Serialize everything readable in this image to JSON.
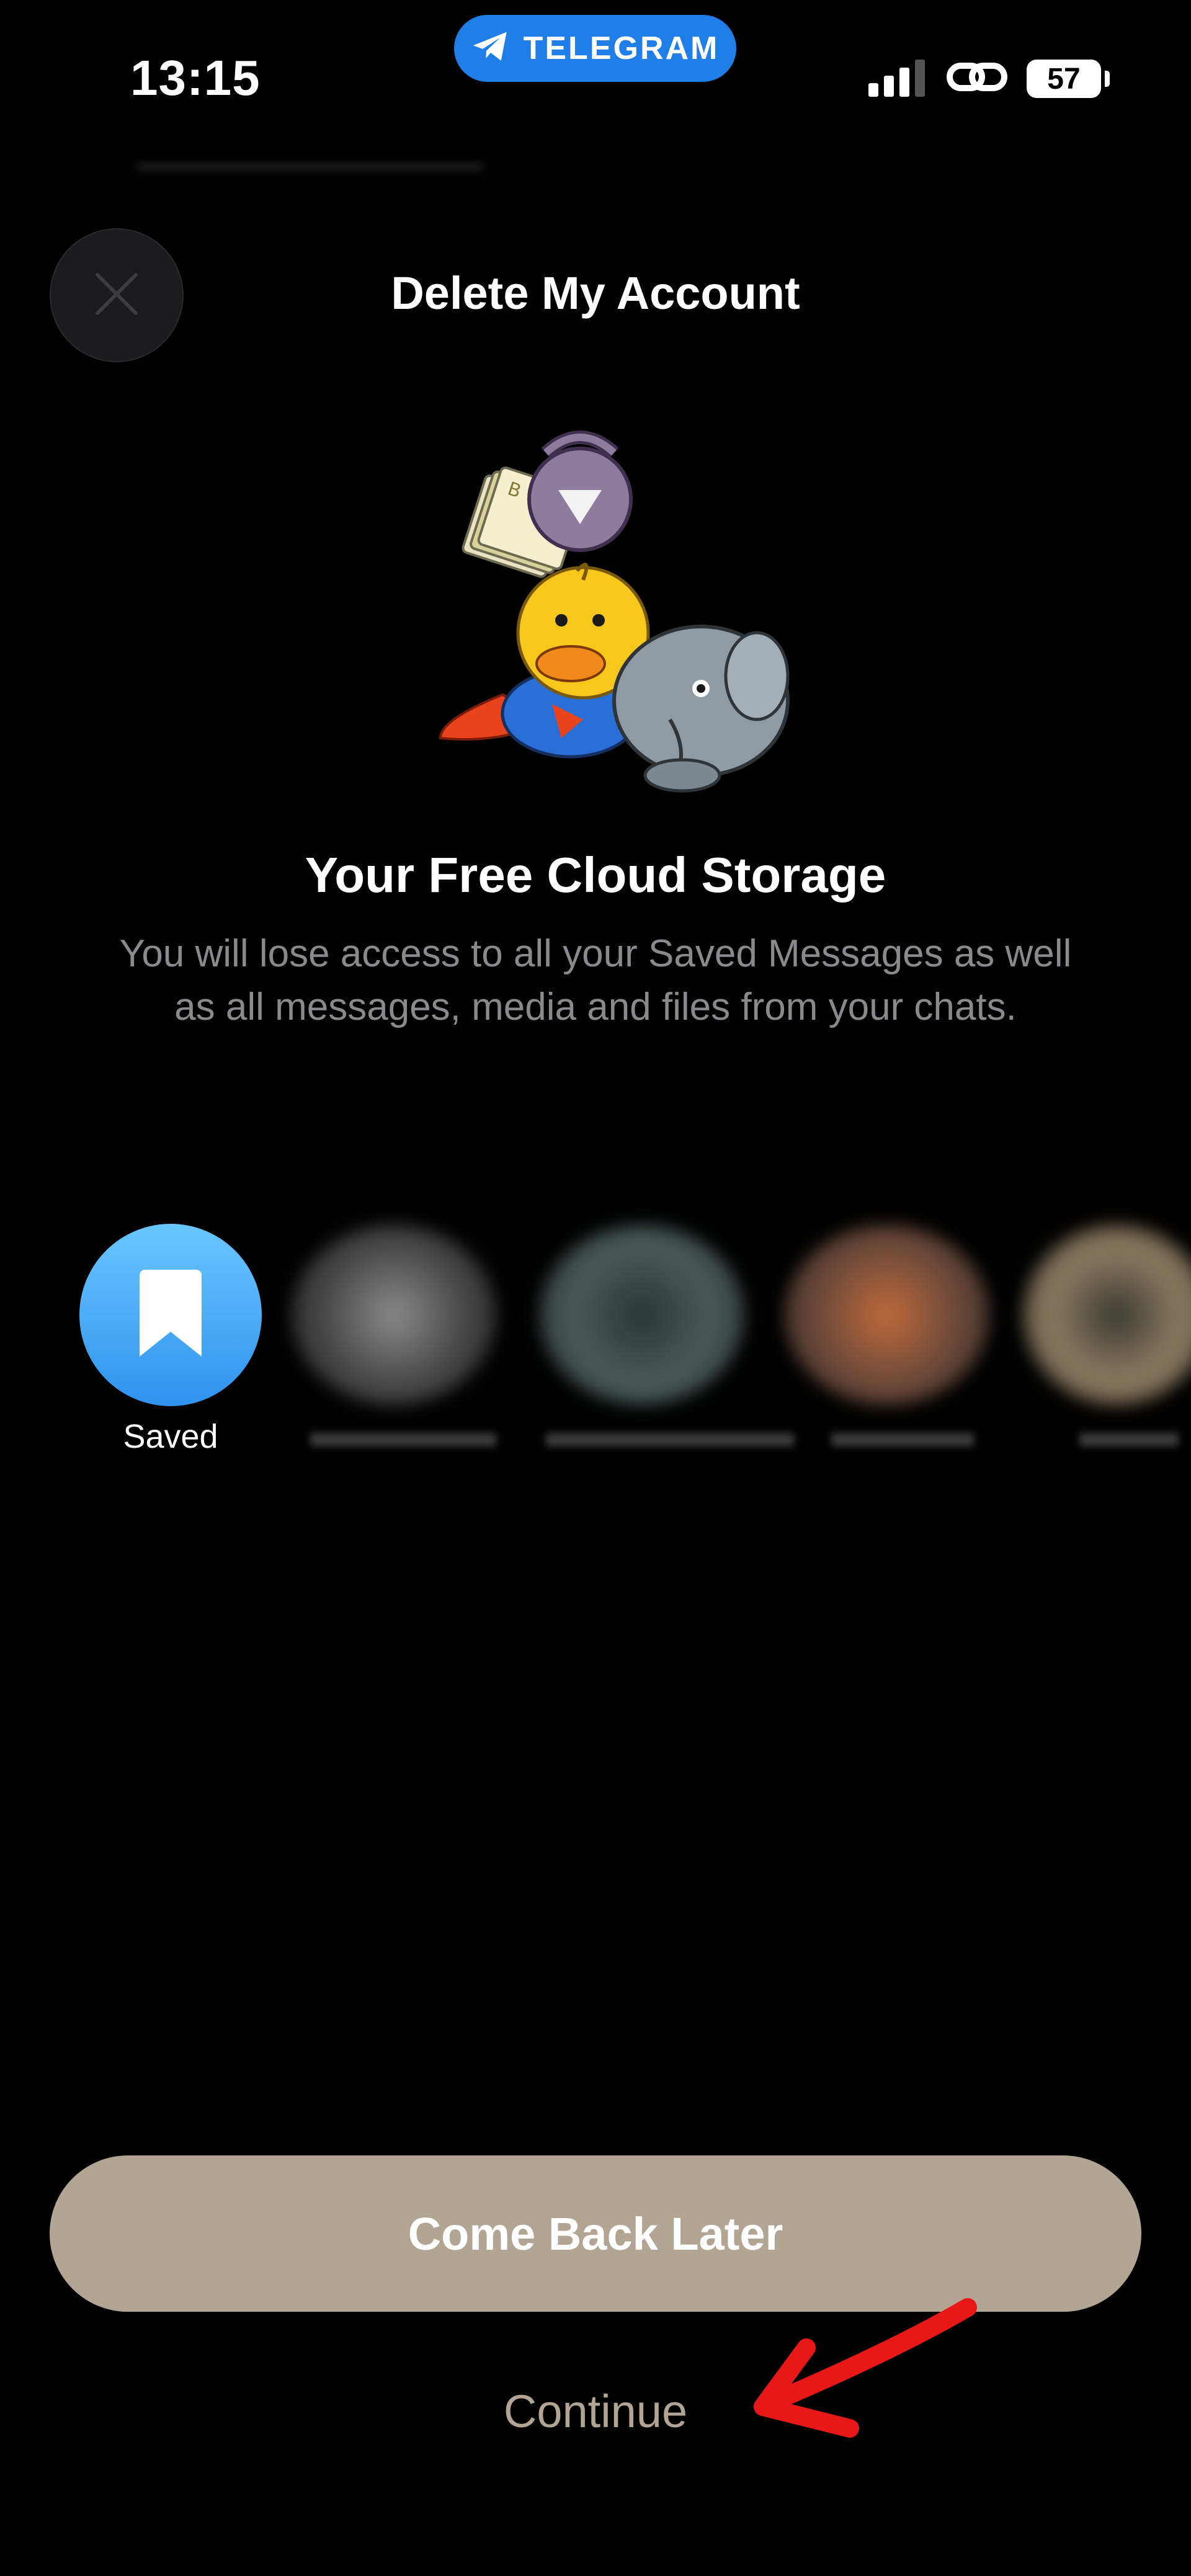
{
  "status_bar": {
    "time": "13:15",
    "app_pill": "TELEGRAM",
    "battery": "57",
    "icons": [
      "telegram-plane-icon",
      "signal-bars-icon",
      "link-icon",
      "battery-icon"
    ]
  },
  "header": {
    "title": "Delete My Account",
    "close_icon": "close-icon"
  },
  "storage": {
    "title": "Your Free Cloud Storage",
    "description": "You will lose access to all your Saved Messages as well as all messages, media and files from your chats."
  },
  "chats": {
    "saved_label": "Saved",
    "saved_icon": "bookmark-icon"
  },
  "actions": {
    "come_back_label": "Come Back Later",
    "continue_label": "Continue",
    "annotation": "red-arrow-icon"
  },
  "colors": {
    "background": "#000000",
    "accent_pill": "#1f7ee8",
    "button": "#b3a593",
    "secondary_text": "#8a8a8e",
    "annotation": "#e81818"
  }
}
